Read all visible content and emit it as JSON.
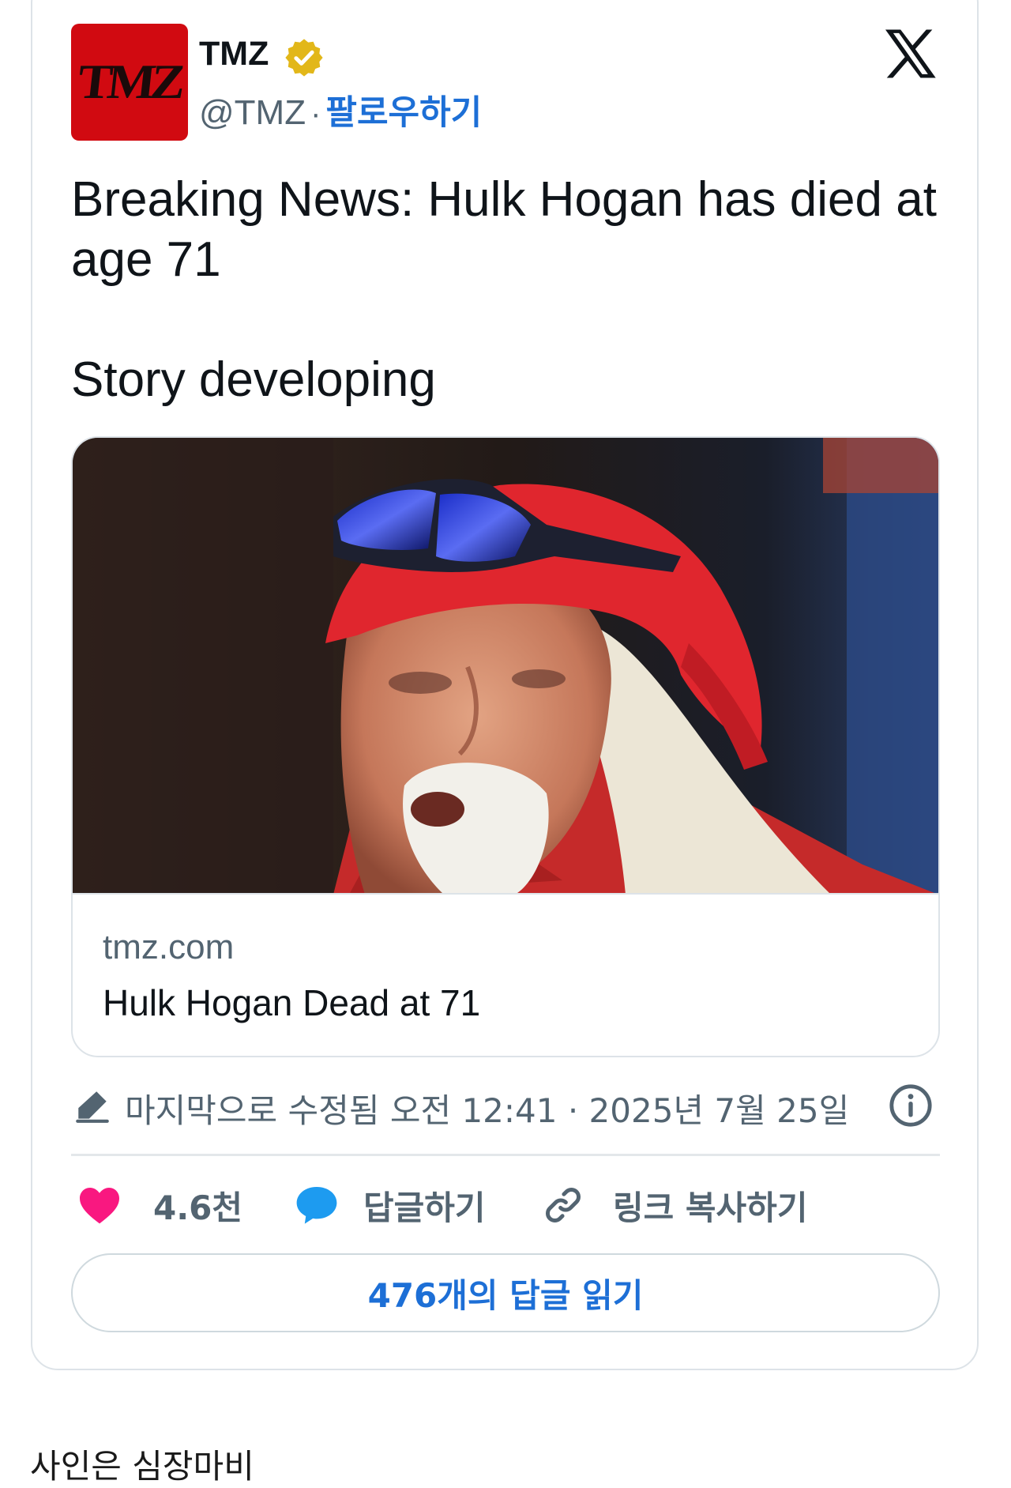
{
  "header": {
    "avatar_text": "TMZ",
    "display_name": "TMZ",
    "handle": "@TMZ",
    "separator": "·",
    "follow_label": "팔로우하기",
    "verified_icon": "verified-badge-icon",
    "platform_icon": "x-logo-icon"
  },
  "tweet": {
    "line1": "Breaking News: Hulk Hogan has died at age 71",
    "line2": "Story developing"
  },
  "link_card": {
    "image_desc": "hulk-hogan-photo",
    "domain": "tmz.com",
    "title": "Hulk Hogan Dead at 71"
  },
  "meta": {
    "edited_text": "마지막으로 수정됨 오전 12:41 · 2025년 7월 25일",
    "edit_icon": "pencil-icon",
    "info_icon": "info-icon"
  },
  "actions": {
    "like_count": "4.6천",
    "reply_label": "답글하기",
    "copy_link_label": "링크 복사하기"
  },
  "read_replies_label": "476개의 답글 읽기",
  "caption": "사인은 심장마비",
  "colors": {
    "brand_red": "#d10a11",
    "link_blue": "#1d6fd6",
    "like_pink": "#f91880",
    "reply_blue": "#1d9bf0",
    "muted_text": "#536471"
  }
}
